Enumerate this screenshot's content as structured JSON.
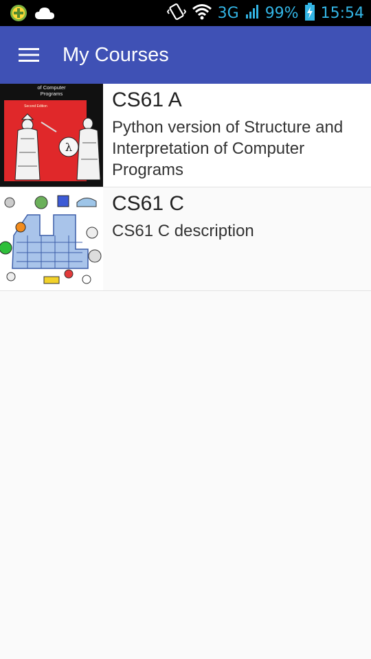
{
  "status_bar": {
    "network": "3G",
    "battery_percent": "99%",
    "time": "15:54",
    "icons": [
      "plus-circle-icon",
      "cloud-icon",
      "vibrate-icon",
      "wifi-icon",
      "signal-icon",
      "battery-charging-icon"
    ]
  },
  "app_bar": {
    "title": "My Courses",
    "background_color": "#3f51b5"
  },
  "courses": [
    {
      "title": "CS61 A",
      "description": "Python version of Structure and Interpretation of Computer Programs",
      "thumbnail": {
        "caption": "of Computer Programs",
        "edition": "Second Edition"
      }
    },
    {
      "title": "CS61 C",
      "description": "CS61 C description"
    }
  ]
}
